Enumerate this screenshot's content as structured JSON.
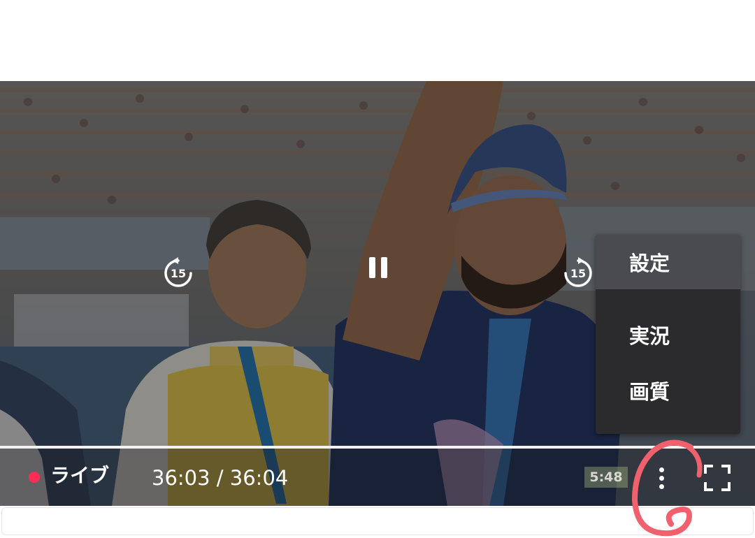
{
  "player": {
    "state": "playing",
    "rewind_seconds": "15",
    "forward_seconds": "15",
    "live_label": "ライブ",
    "time_display": "36:03 / 36:04",
    "progress_fraction": 0.9995,
    "colors": {
      "live_dot": "#ff2d55",
      "menu_bg": "#2b2b2d",
      "menu_active": "#4a4b50"
    },
    "icons": [
      "rewind-15-icon",
      "pause-icon",
      "forward-15-icon",
      "more-vertical-icon",
      "fullscreen-icon"
    ]
  },
  "menu": {
    "items": [
      {
        "label": "設定"
      },
      {
        "label": "実況"
      },
      {
        "label": "画質"
      }
    ]
  },
  "video_overlay": {
    "scoreboard_time": "5:48"
  }
}
